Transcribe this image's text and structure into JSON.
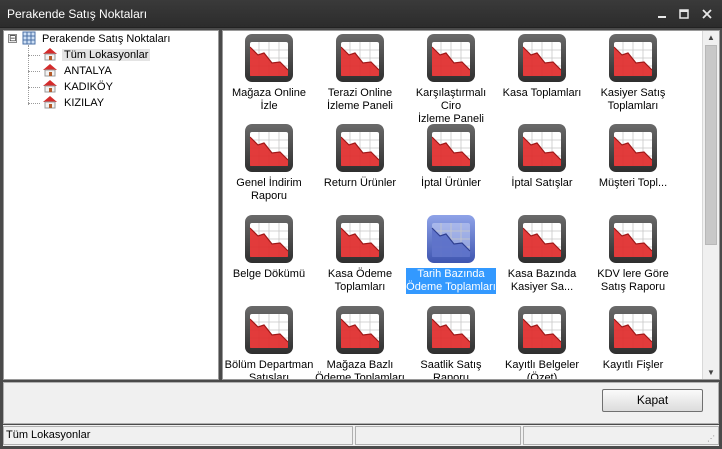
{
  "window": {
    "title": "Perakende Satış Noktaları",
    "min_icon": "minimize-icon",
    "max_icon": "maximize-icon",
    "close_icon": "close-icon"
  },
  "tree": {
    "root": {
      "label": "Perakende Satış Noktaları",
      "icon": "grid-database-icon",
      "expander": "⊟"
    },
    "items": [
      {
        "label": "Tüm Lokasyonlar",
        "icon": "house-icon",
        "selected": true
      },
      {
        "label": "ANTALYA",
        "icon": "house-icon"
      },
      {
        "label": "KADIKÖY",
        "icon": "house-icon"
      },
      {
        "label": "KIZILAY",
        "icon": "house-icon"
      }
    ]
  },
  "reports": [
    {
      "label": "Mağaza Online\nİzle"
    },
    {
      "label": "Terazi Online\nİzleme Paneli"
    },
    {
      "label": "Karşılaştırmalı Ciro\nİzleme Paneli"
    },
    {
      "label": "Kasa Toplamları"
    },
    {
      "label": "Kasiyer Satış\nToplamları"
    },
    {
      "label": "Genel İndirim\nRaporu"
    },
    {
      "label": "Return Ürünler"
    },
    {
      "label": "İptal Ürünler"
    },
    {
      "label": "İptal Satışlar"
    },
    {
      "label": "Müşteri Topl..."
    },
    {
      "label": "Belge Dökümü"
    },
    {
      "label": "Kasa Ödeme\nToplamları"
    },
    {
      "label": "Tarih Bazında\nÖdeme Toplamları",
      "selected": true
    },
    {
      "label": "Kasa Bazında\nKasiyer Sa..."
    },
    {
      "label": "KDV lere Göre\nSatış Raporu"
    },
    {
      "label": "Bölüm Departman\nSatışları"
    },
    {
      "label": "Mağaza Bazlı\nÖdeme Toplamları"
    },
    {
      "label": "Saatlik Satış\nRaporu"
    },
    {
      "label": "Kayıtlı Belgeler\n(Özet)"
    },
    {
      "label": "Kayıtlı Fişler"
    }
  ],
  "buttons": {
    "close_label": "Kapat"
  },
  "status": {
    "left": "Tüm Lokasyonlar",
    "middle": "",
    "right": ""
  },
  "colors": {
    "chart_icon_red": "#e02a2a",
    "chart_icon_selected": "#5a6fc8",
    "selection_blue": "#3399ff"
  }
}
